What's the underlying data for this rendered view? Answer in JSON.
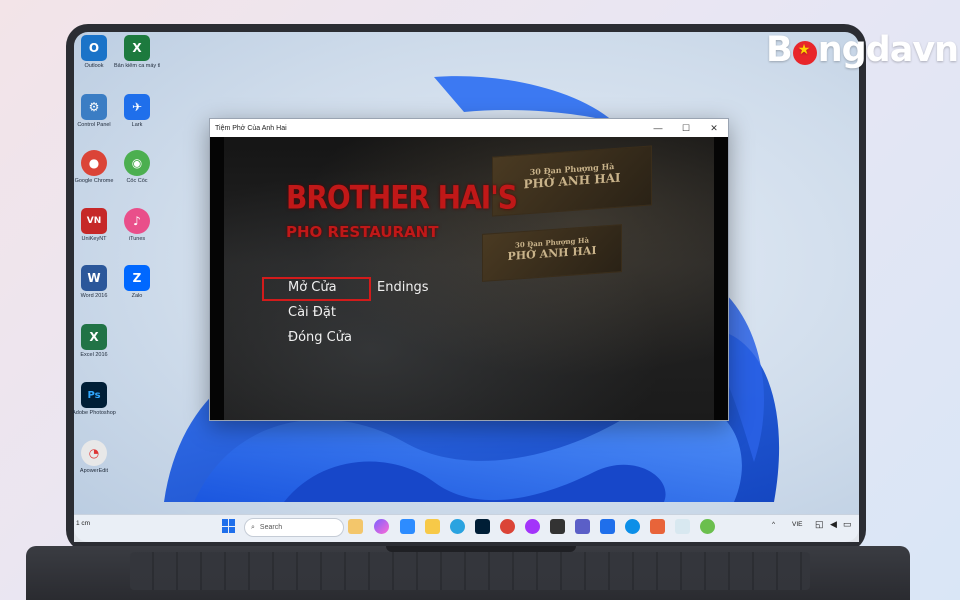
{
  "brand": {
    "logo_prefix": "B",
    "logo_suffix": "ngdavn"
  },
  "desktop_icons": [
    {
      "label": "Outlook",
      "color": "#1a73c8",
      "glyph": "O"
    },
    {
      "label": "Bản kiểm ca máy thông...",
      "color": "#1d7a3e",
      "glyph": "X"
    },
    {
      "label": "Control Panel",
      "color": "#3b7dc4",
      "glyph": "⚙"
    },
    {
      "label": "Lark",
      "color": "#1f6feb",
      "glyph": "✈"
    },
    {
      "label": "Google Chrome",
      "color": "#db4437",
      "glyph": "●"
    },
    {
      "label": "Cốc Cốc",
      "color": "#4caf50",
      "glyph": "◉"
    },
    {
      "label": "UniKeyNT",
      "color": "#c62828",
      "glyph": "VN"
    },
    {
      "label": "iTunes",
      "color": "#e94f8a",
      "glyph": "♪"
    },
    {
      "label": "Word 2016",
      "color": "#2b579a",
      "glyph": "W"
    },
    {
      "label": "Zalo",
      "color": "#0068ff",
      "glyph": "Z"
    },
    {
      "label": "Excel 2016",
      "color": "#217346",
      "glyph": "X"
    },
    {
      "label": "Adobe Photoshop",
      "color": "#001e36",
      "glyph": "Ps"
    },
    {
      "label": "ApowerEdit",
      "color": "#e8e8e8",
      "glyph": "◔"
    }
  ],
  "window": {
    "title": "Tiệm Phở Của Anh Hai",
    "minimize": "—",
    "maximize": "☐",
    "close": "✕"
  },
  "game": {
    "title_line1": "BROTHER HAI'S",
    "title_line2": "PHO RESTAURANT",
    "sign1_line1": "30 Đan Phượng Hà",
    "sign1_line2": "PHỞ ANH HAI",
    "sign2_line1": "30 Đan Phượng Hà",
    "sign2_line2": "PHỞ ANH HAI",
    "menu": {
      "open": "Mở Cửa",
      "endings": "Endings",
      "settings": "Cài Đặt",
      "close": "Đóng Cửa"
    }
  },
  "taskbar": {
    "weather": "1 cm",
    "search_placeholder": "Search",
    "language": "VIE",
    "apps": [
      "widgets",
      "copilot",
      "zoom",
      "file-explorer",
      "telegram",
      "photoshop",
      "chrome",
      "messenger",
      "teams",
      "lark",
      "edge",
      "cloud",
      "app-1",
      "app-2",
      "app-3"
    ]
  }
}
